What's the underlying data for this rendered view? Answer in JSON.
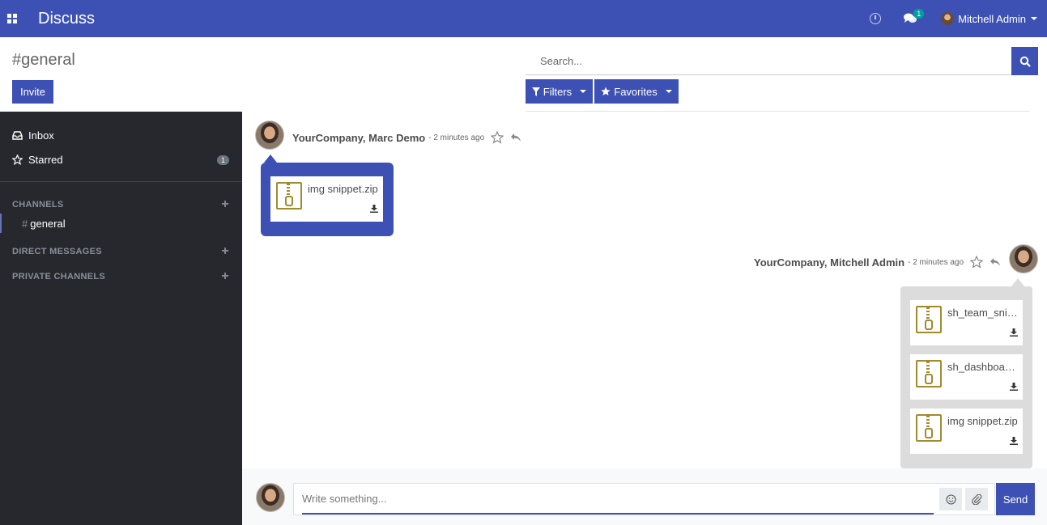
{
  "navbar": {
    "app_title": "Discuss",
    "chat_badge": "1",
    "user_name": "Mitchell Admin"
  },
  "control_panel": {
    "title": "#general",
    "invite_label": "Invite",
    "search_placeholder": "Search...",
    "filters_label": "Filters",
    "favorites_label": "Favorites"
  },
  "sidebar": {
    "inbox_label": "Inbox",
    "starred_label": "Starred",
    "starred_count": "1",
    "channels_header": "CHANNELS",
    "channel_general": "general",
    "direct_messages_header": "DIRECT MESSAGES",
    "private_channels_header": "PRIVATE CHANNELS"
  },
  "messages": [
    {
      "author": "YourCompany, Marc Demo",
      "date": "- 2 minutes ago",
      "attachments": [
        "img snippet.zip"
      ]
    },
    {
      "author": "YourCompany, Mitchell Admin",
      "date": "- 2 minutes ago",
      "attachments": [
        "sh_team_snippet.zip",
        "sh_dashboard_snippet.zip",
        "img snippet.zip"
      ]
    }
  ],
  "composer": {
    "placeholder": "Write something...",
    "send_label": "Send"
  },
  "colors": {
    "primary": "#3d51b5",
    "sidebar_bg": "#26282d",
    "zip_icon": "#a18b2c"
  }
}
